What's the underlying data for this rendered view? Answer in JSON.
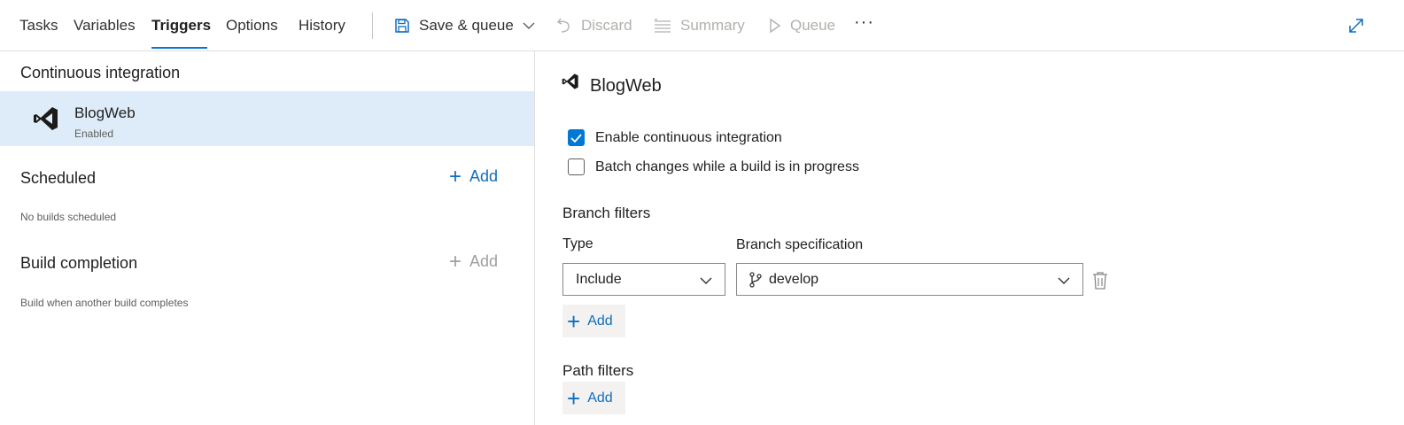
{
  "toolbar": {
    "tabs": [
      "Tasks",
      "Variables",
      "Triggers",
      "Options",
      "History"
    ],
    "active_tab": "Triggers",
    "save_queue_label": "Save & queue",
    "discard_label": "Discard",
    "summary_label": "Summary",
    "queue_label": "Queue",
    "more_label": "···"
  },
  "left": {
    "ci_title": "Continuous integration",
    "ci_item": {
      "name": "BlogWeb",
      "status": "Enabled"
    },
    "scheduled_title": "Scheduled",
    "scheduled_add": "Add",
    "scheduled_empty": "No builds scheduled",
    "completion_title": "Build completion",
    "completion_add": "Add",
    "completion_desc": "Build when another build completes"
  },
  "right": {
    "title": "BlogWeb",
    "enable_ci_label": "Enable continuous integration",
    "enable_ci_checked": true,
    "batch_label": "Batch changes while a build is in progress",
    "batch_checked": false,
    "branch_filters_heading": "Branch filters",
    "type_label": "Type",
    "branch_spec_label": "Branch specification",
    "type_value": "Include",
    "branch_value": "develop",
    "branch_add_label": "Add",
    "path_filters_heading": "Path filters",
    "path_add_label": "Add"
  },
  "icons": {
    "save": "save-icon",
    "discard": "undo-icon",
    "summary": "list-icon",
    "queue": "play-icon",
    "expand": "expand-icon",
    "vs": "visual-studio-icon",
    "branch": "branch-icon",
    "trash": "trash-icon"
  },
  "colors": {
    "accent": "#0078d4",
    "selected_bg": "#deecf9",
    "link": "#106ebe"
  }
}
